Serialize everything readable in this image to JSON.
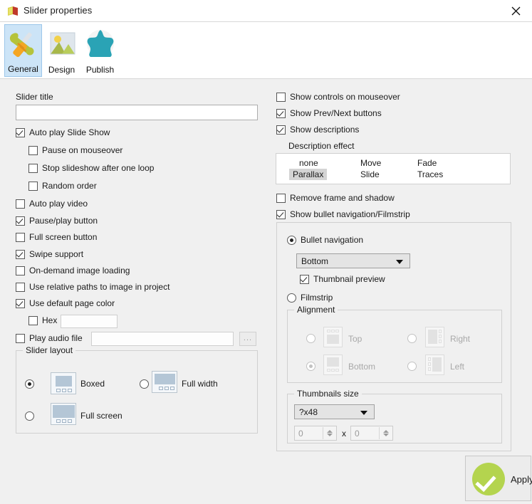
{
  "window": {
    "title": "Slider properties",
    "icon": "app-icon",
    "close_label": "✕"
  },
  "tabs": [
    {
      "label": "General",
      "icon": "wrench-screwdriver-icon",
      "selected": true
    },
    {
      "label": "Design",
      "icon": "picture-icon",
      "selected": false
    },
    {
      "label": "Publish",
      "icon": "globe-icon",
      "selected": false
    }
  ],
  "left": {
    "slider_title_label": "Slider title",
    "slider_title_value": "",
    "slider_title_placeholder": "",
    "checks": [
      {
        "label": "Auto play Slide Show",
        "checked": true
      },
      {
        "label": "Pause on mouseover",
        "checked": false
      },
      {
        "label": "Stop slideshow after one loop",
        "checked": false
      },
      {
        "label": "Random order",
        "checked": false
      },
      {
        "label": "Auto play video",
        "checked": false
      },
      {
        "label": "Pause/play button",
        "checked": true
      },
      {
        "label": "Full screen button",
        "checked": false
      },
      {
        "label": "Swipe support",
        "checked": true
      },
      {
        "label": "On-demand image loading",
        "checked": false
      },
      {
        "label": "Use relative paths to image in project",
        "checked": false
      },
      {
        "label": "Use default page color",
        "checked": true
      },
      {
        "label": "Hex",
        "checked": false
      },
      {
        "label": "Play audio file",
        "checked": false
      }
    ],
    "hex_value": "",
    "audio_value": "",
    "browse_label": "...",
    "layout_group_title": "Slider layout",
    "layout_options": [
      {
        "label": "Boxed",
        "selected": true
      },
      {
        "label": "Full width",
        "selected": false
      },
      {
        "label": "Full screen",
        "selected": false
      }
    ]
  },
  "right": {
    "checks": [
      {
        "label": "Show controls on mouseover",
        "checked": false
      },
      {
        "label": "Show Prev/Next buttons",
        "checked": true
      },
      {
        "label": "Show descriptions",
        "checked": true
      },
      {
        "label": "Remove frame and shadow",
        "checked": false
      },
      {
        "label": "Show bullet navigation/Filmstrip",
        "checked": true
      }
    ],
    "description_effect_label": "Description effect",
    "description_effects": [
      {
        "label": "none",
        "selected": false
      },
      {
        "label": "Move",
        "selected": false
      },
      {
        "label": "Fade",
        "selected": false
      },
      {
        "label": "Parallax",
        "selected": true
      },
      {
        "label": "Slide",
        "selected": false
      },
      {
        "label": "Traces",
        "selected": false
      }
    ],
    "nav_options": [
      {
        "label": "Bullet navigation",
        "selected": true
      },
      {
        "label": "Filmstrip",
        "selected": false
      }
    ],
    "position_value": "Bottom",
    "thumbnail_preview_label": "Thumbnail preview",
    "thumbnail_preview_checked": true,
    "alignment_group_title": "Alignment",
    "alignment_options": [
      {
        "label": "Top",
        "selected": false
      },
      {
        "label": "Right",
        "selected": false
      },
      {
        "label": "Bottom",
        "selected": true
      },
      {
        "label": "Left",
        "selected": false
      }
    ],
    "thumbnails_size_title": "Thumbnails size",
    "thumbnails_size_value": "?x48",
    "thumb_width": "0",
    "thumb_height": "0",
    "size_separator": "x"
  },
  "footer": {
    "apply_label": "Apply"
  },
  "colors": {
    "background": "#f0f0f0",
    "titlebar": "#ffffff",
    "tab_selected": "#cce4f7",
    "apply_green": "#b4d44e",
    "selection_gray": "#d4d4d4"
  }
}
